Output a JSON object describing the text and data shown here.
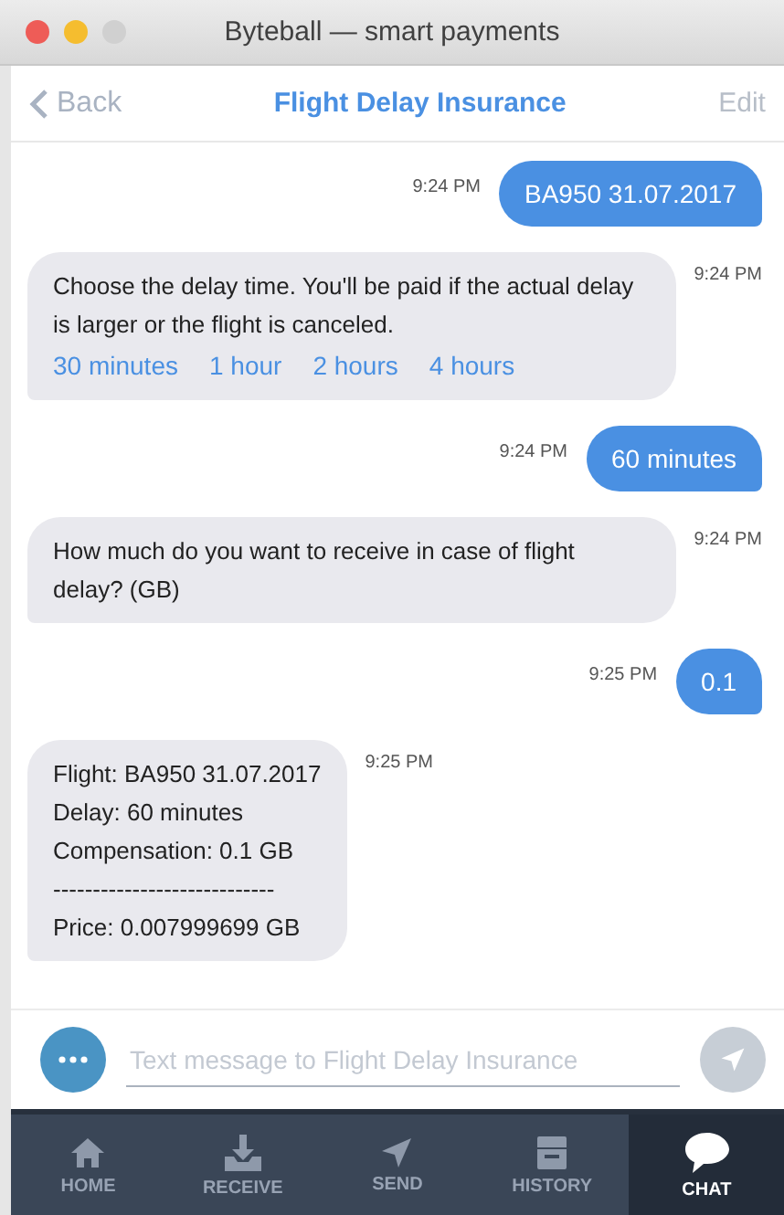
{
  "window": {
    "title": "Byteball — smart payments"
  },
  "nav": {
    "back": "Back",
    "title": "Flight Delay Insurance",
    "edit": "Edit"
  },
  "messages": [
    {
      "kind": "outgoing",
      "time": "9:24 PM",
      "lines": [
        "BA950 31.07.2017"
      ]
    },
    {
      "kind": "incoming",
      "time": "9:24 PM",
      "lines": [
        "Choose the delay time. You'll be paid if the actual delay is larger or the flight is canceled."
      ],
      "options": [
        "30 minutes",
        "1 hour",
        "2 hours",
        "4 hours"
      ]
    },
    {
      "kind": "outgoing",
      "time": "9:24 PM",
      "lines": [
        "60 minutes"
      ]
    },
    {
      "kind": "incoming",
      "time": "9:24 PM",
      "lines": [
        "How much do you want to receive in case of flight delay? (GB)"
      ]
    },
    {
      "kind": "outgoing",
      "time": "9:25 PM",
      "lines": [
        "0.1"
      ]
    },
    {
      "kind": "incoming",
      "time": "9:25 PM",
      "lines": [
        "Flight: BA950 31.07.2017",
        "Delay: 60 minutes",
        "Compensation: 0.1 GB",
        "----------------------------",
        "Price: 0.007999699 GB"
      ]
    }
  ],
  "composer": {
    "placeholder": "Text message to Flight Delay Insurance"
  },
  "tabs": [
    {
      "kind": "home",
      "label": "HOME",
      "selected": false
    },
    {
      "kind": "receive",
      "label": "RECEIVE",
      "selected": false
    },
    {
      "kind": "send",
      "label": "SEND",
      "selected": false
    },
    {
      "kind": "history",
      "label": "HISTORY",
      "selected": false
    },
    {
      "kind": "chat",
      "label": "CHAT",
      "selected": true
    }
  ]
}
